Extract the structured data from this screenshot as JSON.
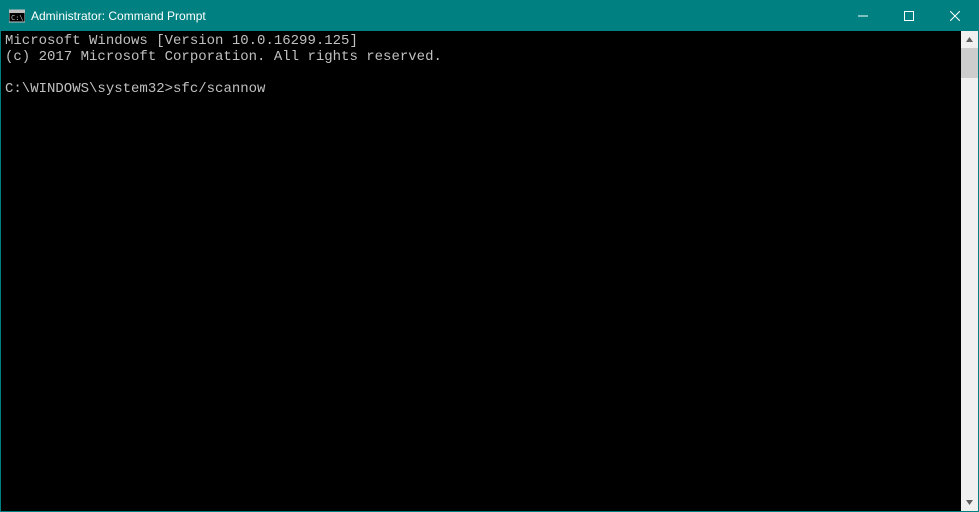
{
  "titlebar": {
    "title": "Administrator: Command Prompt"
  },
  "terminal": {
    "line1": "Microsoft Windows [Version 10.0.16299.125]",
    "line2": "(c) 2017 Microsoft Corporation. All rights reserved.",
    "blank": "",
    "prompt": "C:\\WINDOWS\\system32>",
    "command": "sfc/scannow"
  }
}
